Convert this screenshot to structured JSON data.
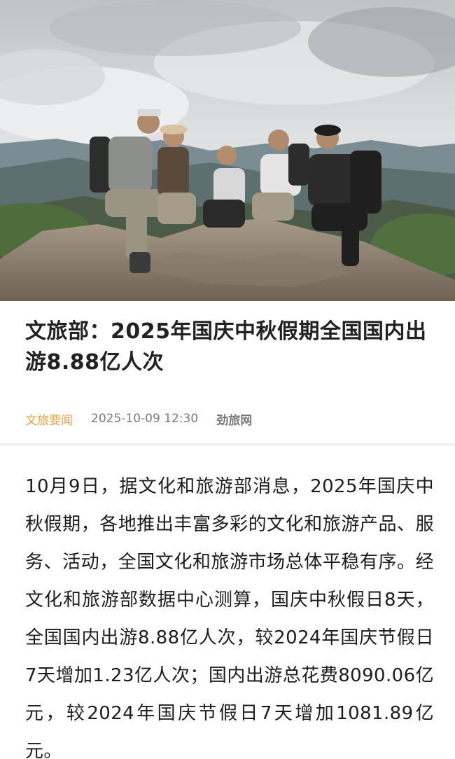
{
  "article": {
    "hero_image_alt": "",
    "title": "文旅部：2025年国庆中秋假期全国国内出游8.88亿人次",
    "channel": "文旅要闻",
    "published_at": "2025-10-09 12:30",
    "source": "劲旅网",
    "body": "10月9日，据文化和旅游部消息，2025年国庆中秋假期，各地推出丰富多彩的文化和旅游产品、服务、活动，全国文化和旅游市场总体平稳有序。经文化和旅游部数据中心测算，国庆中秋假日8天，全国国内出游8.88亿人次，较2024年国庆节假日7天增加1.23亿人次；国内出游总花费8090.06亿元，较2024年国庆节假日7天增加1081.89亿元。"
  },
  "colors": {
    "channel": "#e8a24a",
    "meta_text": "#7a7a7a",
    "title": "#222222",
    "body": "#1d1d1d"
  }
}
